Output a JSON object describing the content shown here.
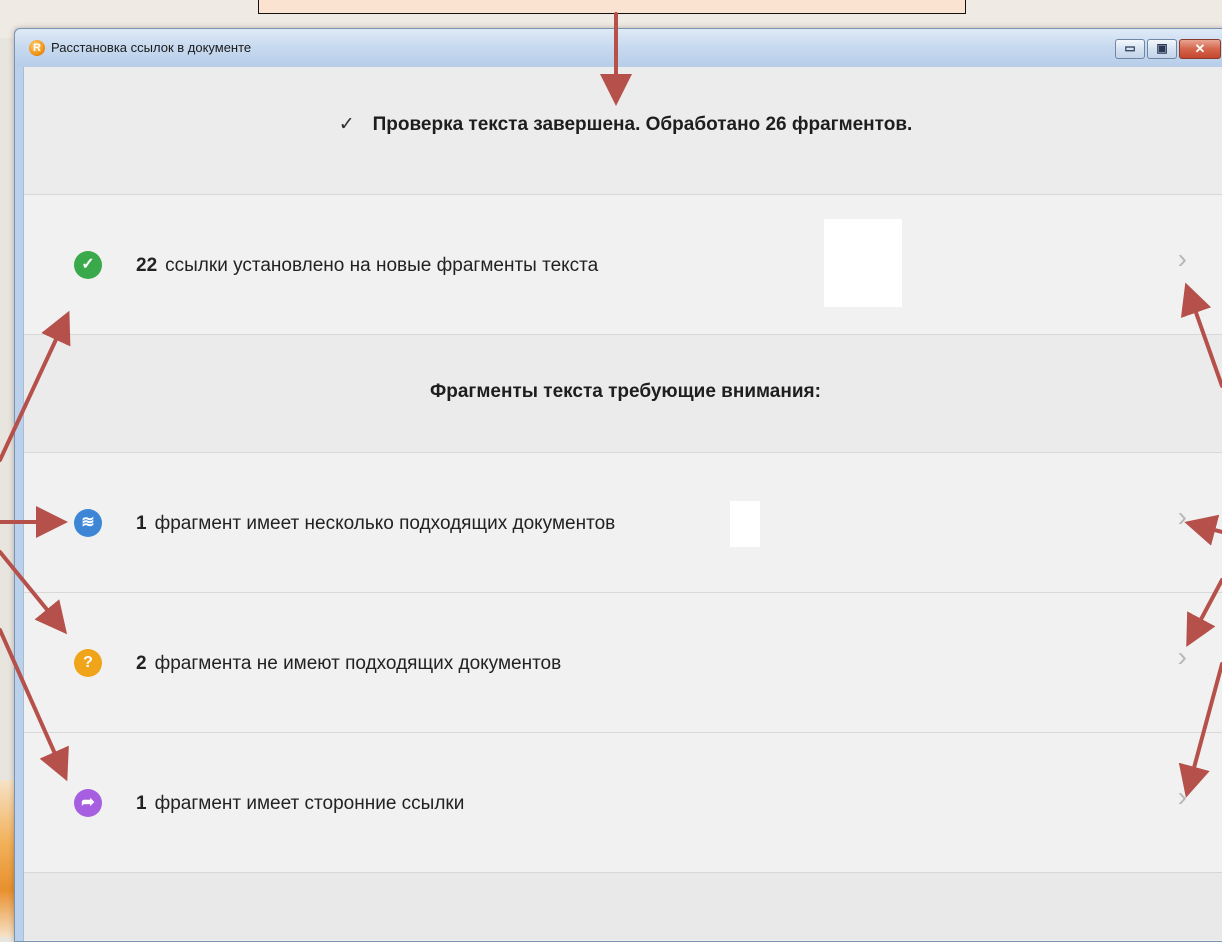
{
  "window": {
    "title": "Расстановка ссылок в документе",
    "app_icon": "R-logo-icon",
    "controls": {
      "minimize": "▭",
      "maximize": "▣",
      "close": "✕"
    }
  },
  "status": {
    "check_icon": "✓",
    "text": "Проверка текста завершена. Обработано 26 фрагментов."
  },
  "items": [
    {
      "count": "22",
      "text": "ссылки установлено на новые фрагменты текста",
      "icon": "check-icon",
      "glyph": "✓",
      "color": "#3aa94b"
    },
    {
      "count": "1",
      "text": "фрагмент имеет несколько подходящих документов",
      "icon": "layers-icon",
      "glyph": "≋",
      "color": "#3d86d6"
    },
    {
      "count": "2",
      "text": "фрагмента не имеют подходящих документов",
      "icon": "question-icon",
      "glyph": "?",
      "color": "#f0a41a"
    },
    {
      "count": "1",
      "text": "фрагмент имеет сторонние ссылки",
      "icon": "share-arrow-icon",
      "glyph": "➦",
      "color": "#a55fe0"
    }
  ],
  "section": {
    "title": "Фрагменты текста требующие внимания:"
  },
  "chevron": "›",
  "annotation_color": "#b5504a"
}
